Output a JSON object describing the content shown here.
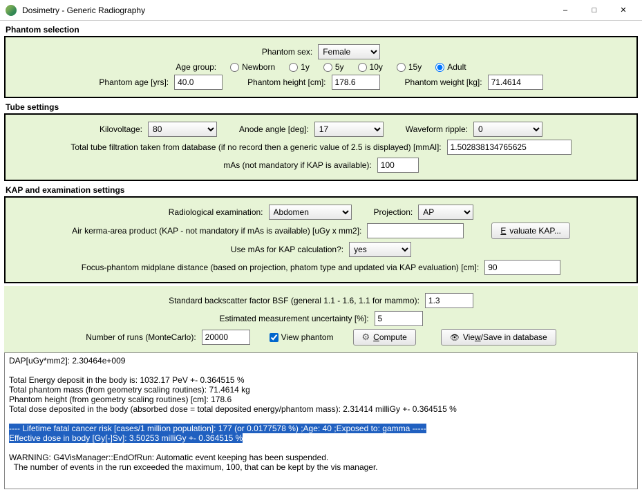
{
  "window": {
    "title": "Dosimetry - Generic Radiography"
  },
  "phantom": {
    "heading": "Phantom selection",
    "sex_label": "Phantom sex:",
    "sex_value": "Female",
    "age_group_label": "Age group:",
    "age_options": [
      "Newborn",
      "1y",
      "5y",
      "10y",
      "15y",
      "Adult"
    ],
    "age_selected": "Adult",
    "age_yrs_label": "Phantom age [yrs]:",
    "age_yrs_value": "40.0",
    "height_label": "Phantom height [cm]:",
    "height_value": "178.6",
    "weight_label": "Phantom weight [kg]:",
    "weight_value": "71.4614"
  },
  "tube": {
    "heading": "Tube settings",
    "kv_label": "Kilovoltage:",
    "kv_value": "80",
    "anode_label": "Anode angle [deg]:",
    "anode_value": "17",
    "ripple_label": "Waveform ripple:",
    "ripple_value": "0",
    "filtration_label": "Total tube filtration taken from database (if no record then a generic value of 2.5 is displayed) [mmAl]:",
    "filtration_value": "1.502838134765625",
    "mas_label": "mAs (not mandatory if KAP is available):",
    "mas_value": "100"
  },
  "kap": {
    "heading": "KAP and examination settings",
    "exam_label": "Radiological examination:",
    "exam_value": "Abdomen",
    "proj_label": "Projection:",
    "proj_value": "AP",
    "kap_label": "Air kerma-area product (KAP - not mandatory if mAs is available) [uGy x mm2]:",
    "kap_value": "",
    "evaluate_btn": "Evaluate KAP...",
    "use_mas_label": "Use mAs for KAP calculation?:",
    "use_mas_value": "yes",
    "fpd_label": "Focus-phantom midplane distance (based on projection, phatom type and updated via KAP evaluation) [cm]:",
    "fpd_value": "90"
  },
  "params": {
    "bsf_label": "Standard backscatter factor BSF (general 1.1 - 1.6, 1.1 for mammo):",
    "bsf_value": "1.3",
    "unc_label": "Estimated measurement uncertainty [%]:",
    "unc_value": "5",
    "runs_label": "Number of runs (MonteCarlo):",
    "runs_value": "20000",
    "view_phantom_label": "View phantom",
    "compute_btn": "Compute",
    "save_btn": "View/Save in database"
  },
  "output": {
    "line1": "DAP[uGy*mm2]: 2.30464e+009",
    "line2": "",
    "line3": "Total Energy deposit in the body is: 1032.17 PeV +- 0.364515 %",
    "line4": "Total phantom mass (from geometry scaling routines): 71.4614 kg",
    "line5": "Phantom height (from geometry scaling routines) [cm]: 178.6",
    "line6": "Total dose deposited in the body (absorbed dose = total deposited energy/phantom mass): 2.31414 milliGy +- 0.364515 %",
    "hl1": "---- Lifetime fatal cancer risk [cases/1 million population]: 177 (or 0.0177578 %) ;Age: 40 ;Exposed to: gamma -----",
    "hl2": "Effective dose in body [Gy[-]Sv]: 3.50253 milliGy +- 0.364515 %",
    "line9": "WARNING: G4VisManager::EndOfRun: Automatic event keeping has been suspended.",
    "line10": "  The number of events in the run exceeded the maximum, 100, that can be kept by the vis manager."
  }
}
